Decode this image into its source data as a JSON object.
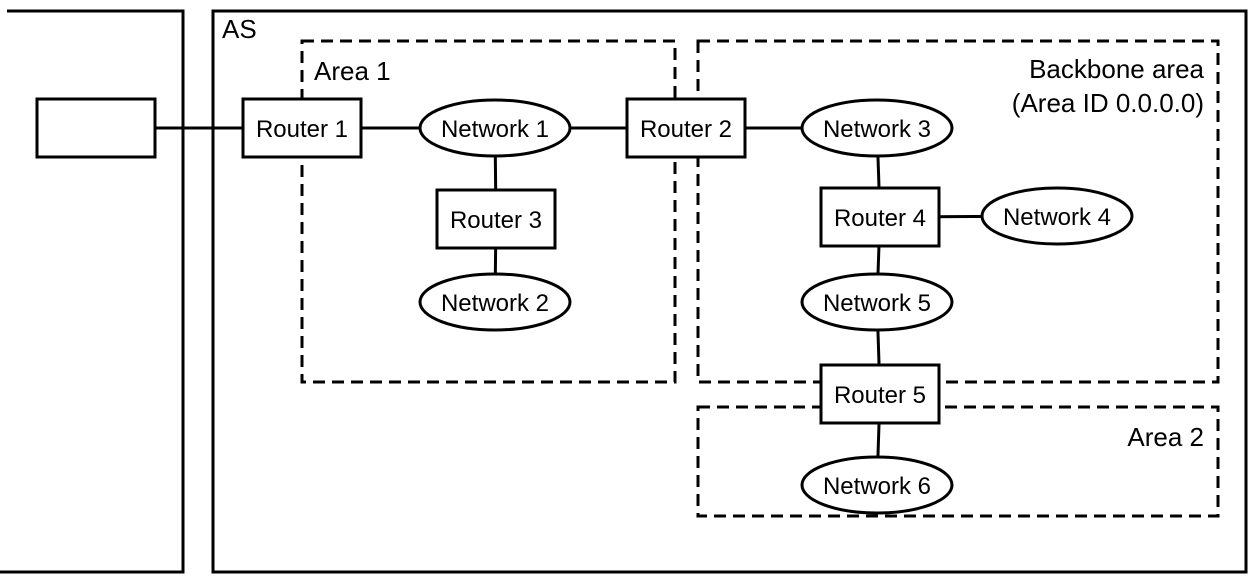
{
  "labels": {
    "as": "AS",
    "area1": "Area 1",
    "backbone_line1": "Backbone area",
    "backbone_line2": "(Area ID 0.0.0.0)",
    "area2": "Area 2"
  },
  "routers": {
    "r1": "Router 1",
    "r2": "Router 2",
    "r3": "Router 3",
    "r4": "Router 4",
    "r5": "Router 5"
  },
  "networks": {
    "n1": "Network 1",
    "n2": "Network 2",
    "n3": "Network 3",
    "n4": "Network 4",
    "n5": "Network 5",
    "n6": "Network 6"
  },
  "connections": [
    [
      "external",
      "r1"
    ],
    [
      "r1",
      "n1"
    ],
    [
      "n1",
      "r2"
    ],
    [
      "n1",
      "r3"
    ],
    [
      "r3",
      "n2"
    ],
    [
      "r2",
      "n3"
    ],
    [
      "n3",
      "r4"
    ],
    [
      "r4",
      "n4"
    ],
    [
      "r4",
      "n5"
    ],
    [
      "n5",
      "r5"
    ],
    [
      "r5",
      "n6"
    ]
  ]
}
